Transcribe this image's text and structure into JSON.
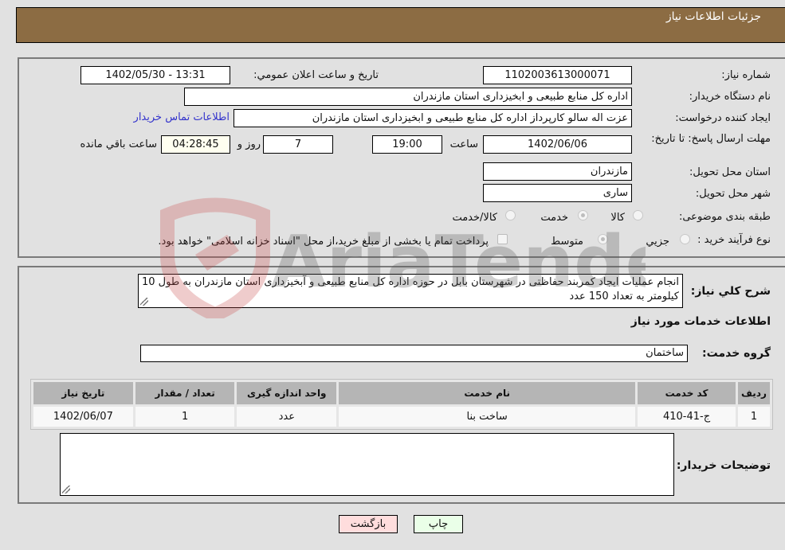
{
  "header": {
    "title": "جزئیات اطلاعات نیاز"
  },
  "details": {
    "need_number": {
      "label": "شماره نیاز:",
      "value": "1102003613000071"
    },
    "announce_datetime": {
      "label": "تاریخ و ساعت اعلان عمومي:",
      "value": "1402/05/30 - 13:31"
    },
    "buyer_org": {
      "label": "نام دستگاه خریدار:",
      "value": "اداره کل منابع طبیعی و ابخیزداری استان مازندران"
    },
    "requester": {
      "label": "ایجاد کننده درخواست:",
      "value": "عزت اله سالو کارپرداز اداره کل منابع طبیعی و ابخیزداری استان مازندران"
    },
    "buyer_contact_link": "اطلاعات تماس خریدار",
    "deadline": {
      "label": "مهلت ارسال پاسخ: تا تاریخ:",
      "date": "1402/06/06",
      "time_label": "ساعت",
      "time": "19:00",
      "days": "7",
      "days_label": "روز و",
      "remaining": "04:28:45",
      "remaining_label": "ساعت باقي مانده"
    },
    "delivery_province": {
      "label": "استان محل تحویل:",
      "value": "مازندران"
    },
    "delivery_city": {
      "label": "شهر محل تحویل:",
      "value": "ساری"
    },
    "category": {
      "label": "طبقه بندی موضوعی:",
      "options": [
        "کالا",
        "خدمت",
        "کالا/خدمت"
      ],
      "selected": "خدمت"
    },
    "purchase_type": {
      "label": "نوع فرآیند خرید :",
      "options": [
        "جزيي",
        "متوسط"
      ],
      "selected": "متوسط",
      "payment_note": "پرداخت تمام یا بخشی از مبلغ خرید،از محل \"اسناد خزانه اسلامی\" خواهد بود."
    }
  },
  "description": {
    "label": "شرح کلي نیاز:",
    "value": "انجام عملیات ایجاد کمربند حفاظتی در شهرستان بابل در حوزه اداره کل منابع طبیعی و آبخیزداری استان مازندران به طول 10 کیلومتر به تعداد 150 عدد"
  },
  "services": {
    "section_title": "اطلاعات خدمات مورد نیاز",
    "group_label": "گروه خدمت:",
    "group_value": "ساختمان",
    "table": {
      "headers": [
        "ردیف",
        "کد خدمت",
        "نام خدمت",
        "واحد اندازه گیری",
        "تعداد / مقدار",
        "تاریخ نیاز"
      ],
      "rows": [
        [
          "1",
          "ج-41-410",
          "ساخت بنا",
          "عدد",
          "1",
          "1402/06/07"
        ]
      ]
    }
  },
  "buyer_notes": {
    "label": "توضیحات خریدار:",
    "value": ""
  },
  "buttons": {
    "print": "چاپ",
    "back": "بازگشت"
  },
  "watermark": {
    "text": "AriaTender.neT"
  },
  "colors": {
    "header_bg": "#8c6c43",
    "link": "#3333cc",
    "print_bg": "#eaffe8",
    "back_bg": "#ffdddd"
  }
}
